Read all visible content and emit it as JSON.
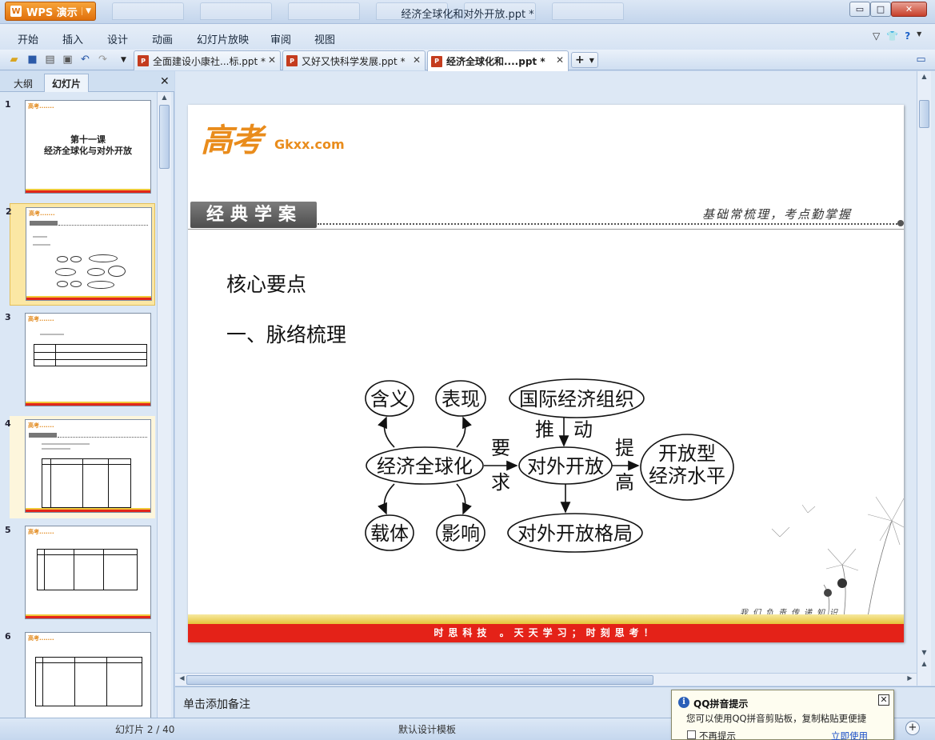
{
  "app": {
    "logo_label": "WPS 演示",
    "window_title": "经济全球化和对外开放.ppt *"
  },
  "window_controls": {
    "minimize": "▭",
    "maximize": "□",
    "close": "✕"
  },
  "menu": {
    "items": [
      "开始",
      "插入",
      "设计",
      "动画",
      "幻灯片放映",
      "审阅",
      "视图"
    ]
  },
  "doc_tabs": [
    {
      "label": "全面建设小康社...标.ppt *"
    },
    {
      "label": "又好又快科学发展.ppt *"
    },
    {
      "label": "经济全球化和....ppt *"
    }
  ],
  "left_panel": {
    "tabs": [
      "大纲",
      "幻灯片"
    ],
    "close": "✕"
  },
  "thumbnails": [
    {
      "number": "1",
      "title_line1": "第十一课",
      "title_line2": "经济全球化与对外开放"
    },
    {
      "number": "2"
    },
    {
      "number": "3"
    },
    {
      "number": "4"
    },
    {
      "number": "5"
    },
    {
      "number": "6"
    }
  ],
  "slide": {
    "logo_text": "高考",
    "logo_site": "Gkxx.com",
    "banner": "经典学案",
    "tagline": "基础常梳理，考点勤掌握",
    "heading1": "核心要点",
    "heading2": "一、脉络梳理",
    "footer_motto": "我们负责传递知识",
    "footer_bar": "时思科技 。天天学习；时刻思考！",
    "diagram": {
      "center": "经济全球化",
      "top_left": "含义",
      "top_right": "表现",
      "bottom_left": "载体",
      "bottom_right": "影响",
      "middle": "对外开放",
      "top_org": "国际经济组织",
      "bottom_pattern": "对外开放格局",
      "right_line1": "开放型",
      "right_line2": "经济水平",
      "label_require_1": "要",
      "label_require_2": "求",
      "label_push": "推　动",
      "label_raise_1": "提",
      "label_raise_2": "高"
    }
  },
  "notes": {
    "placeholder": "单击添加备注"
  },
  "status": {
    "slide_info": "幻灯片 2 / 40",
    "template": "默认设计模板"
  },
  "qq_popup": {
    "title": "QQ拼音提示",
    "message": "您可以使用QQ拼音剪贴板，复制粘贴更便捷",
    "dont_show": "不再提示",
    "use_now": "立即使用"
  },
  "colors": {
    "accent_orange": "#e98c1c",
    "footer_red": "#e42218",
    "selection": "#fbe7a4"
  }
}
